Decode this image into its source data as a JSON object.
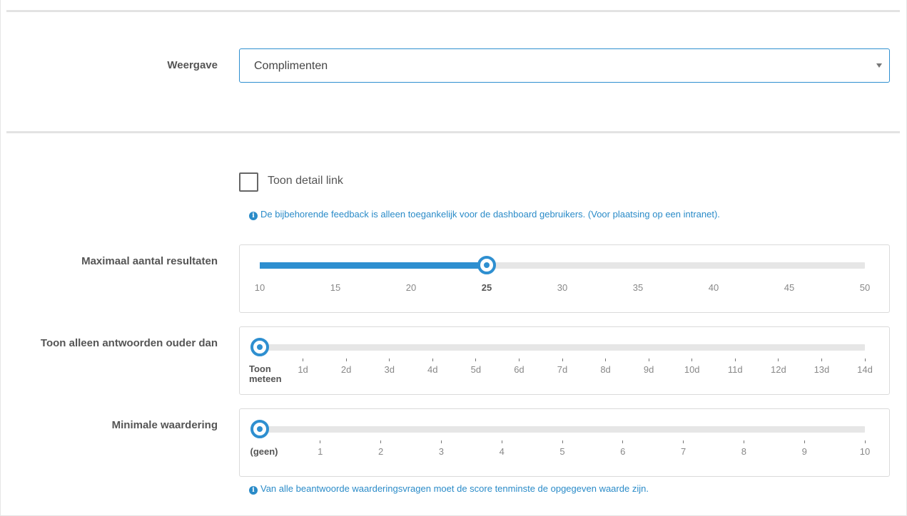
{
  "display": {
    "label": "Weergave",
    "selected": "Complimenten"
  },
  "detail_link": {
    "label": "Toon detail link",
    "checked": false,
    "info": "De bijbehorende feedback is alleen toegankelijk voor de dashboard gebruikers. (Voor plaatsing op een intranet)."
  },
  "max_results": {
    "label": "Maximaal aantal resultaten",
    "value": 25,
    "min": 10,
    "max": 50,
    "ticks": [
      "10",
      "15",
      "20",
      "25",
      "30",
      "35",
      "40",
      "45",
      "50"
    ]
  },
  "older_than": {
    "label": "Toon alleen antwoorden ouder dan",
    "value_index": 0,
    "ticks": [
      "Toon meteen",
      "1d",
      "2d",
      "3d",
      "4d",
      "5d",
      "6d",
      "7d",
      "8d",
      "9d",
      "10d",
      "11d",
      "12d",
      "13d",
      "14d"
    ]
  },
  "min_rating": {
    "label": "Minimale waardering",
    "value_index": 0,
    "ticks": [
      "(geen)",
      "1",
      "2",
      "3",
      "4",
      "5",
      "6",
      "7",
      "8",
      "9",
      "10"
    ],
    "info": "Van alle beantwoorde waarderingsvragen moet de score tenminste de opgegeven waarde zijn."
  },
  "colors": {
    "accent": "#2e8fd0",
    "info": "#2a8bc8",
    "track": "#e6e6e6"
  },
  "icons": {
    "info": "info-icon",
    "dropdown": "chevron-down-icon"
  }
}
